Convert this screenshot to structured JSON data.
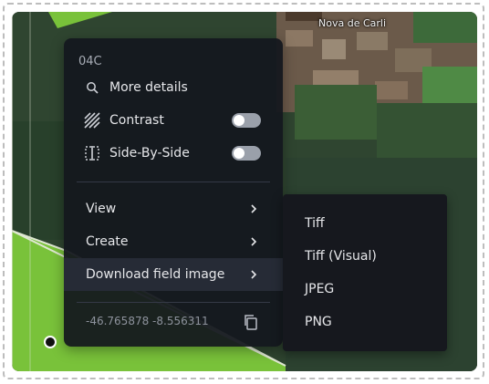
{
  "map": {
    "place_label": "Nova de Carli"
  },
  "context_menu": {
    "title": "04C",
    "more_details": "More details",
    "contrast": "Contrast",
    "contrast_on": false,
    "side_by_side": "Side-By-Side",
    "side_by_side_on": false,
    "view": "View",
    "create": "Create",
    "download_field_image": "Download field image",
    "coordinates": "-46.765878 -8.556311"
  },
  "download_submenu": {
    "items": [
      "Tiff",
      "Tiff (Visual)",
      "JPEG",
      "PNG"
    ]
  },
  "icons": {
    "more_details": "search-icon",
    "contrast": "hatch-icon",
    "side_by_side": "split-view-icon",
    "submenu": "chevron-right-icon",
    "copy": "copy-icon"
  },
  "colors": {
    "menu_background": "#14171e",
    "submenu_background": "#16181e",
    "active_row": "#262b36",
    "toggle_off": "#9aa0aa",
    "field_green": "#79c23a"
  }
}
